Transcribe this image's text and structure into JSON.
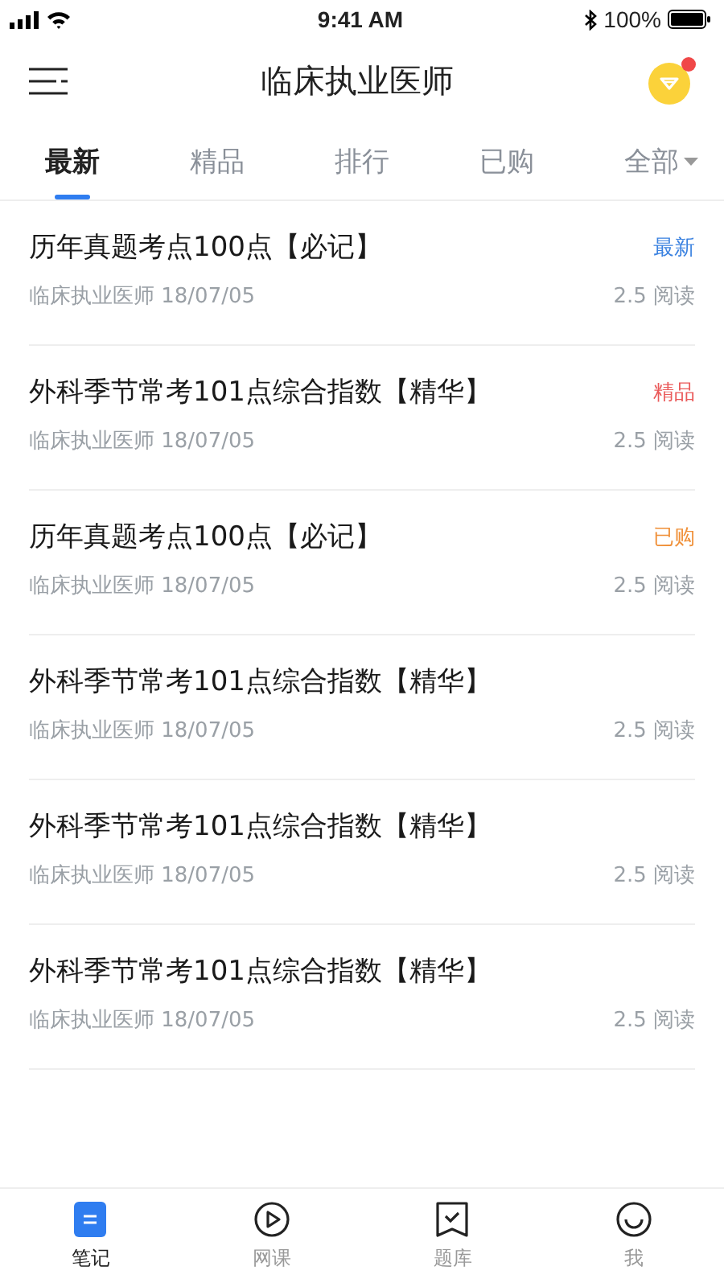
{
  "status_bar": {
    "time": "9:41 AM",
    "battery": "100%"
  },
  "header": {
    "title": "临床执业医师",
    "notification_dot": true
  },
  "tabs": [
    {
      "label": "最新",
      "selected": true
    },
    {
      "label": "精品",
      "selected": false
    },
    {
      "label": "排行",
      "selected": false
    },
    {
      "label": "已购",
      "selected": false
    },
    {
      "label": "全部",
      "selected": false,
      "dropdown": true
    }
  ],
  "articles": [
    {
      "title": "历年真题考点100点【必记】",
      "source": "临床执业医师",
      "date": "18/07/05",
      "reads": "2.5 阅读",
      "tag": {
        "label": "最新",
        "color": "#3b82e0"
      }
    },
    {
      "title": "外科季节常考101点综合指数【精华】",
      "source": "临床执业医师",
      "date": "18/07/05",
      "reads": "2.5 阅读",
      "tag": {
        "label": "精品",
        "color": "#ea5a5a"
      }
    },
    {
      "title": "历年真题考点100点【必记】",
      "source": "临床执业医师",
      "date": "18/07/05",
      "reads": "2.5 阅读",
      "tag": {
        "label": "已购",
        "color": "#f0913a"
      }
    },
    {
      "title": "外科季节常考101点综合指数【精华】",
      "source": "临床执业医师",
      "date": "18/07/05",
      "reads": "2.5 阅读"
    },
    {
      "title": "外科季节常考101点综合指数【精华】",
      "source": "临床执业医师",
      "date": "18/07/05",
      "reads": "2.5 阅读"
    },
    {
      "title": "外科季节常考101点综合指数【精华】",
      "source": "临床执业医师",
      "date": "18/07/05",
      "reads": "2.5 阅读"
    }
  ],
  "bottom_nav": [
    {
      "label": "笔记",
      "kind": "note",
      "selected": true
    },
    {
      "label": "网课",
      "kind": "play",
      "selected": false
    },
    {
      "label": "题库",
      "kind": "bookmark",
      "selected": false
    },
    {
      "label": "我",
      "kind": "smile",
      "selected": false
    }
  ]
}
